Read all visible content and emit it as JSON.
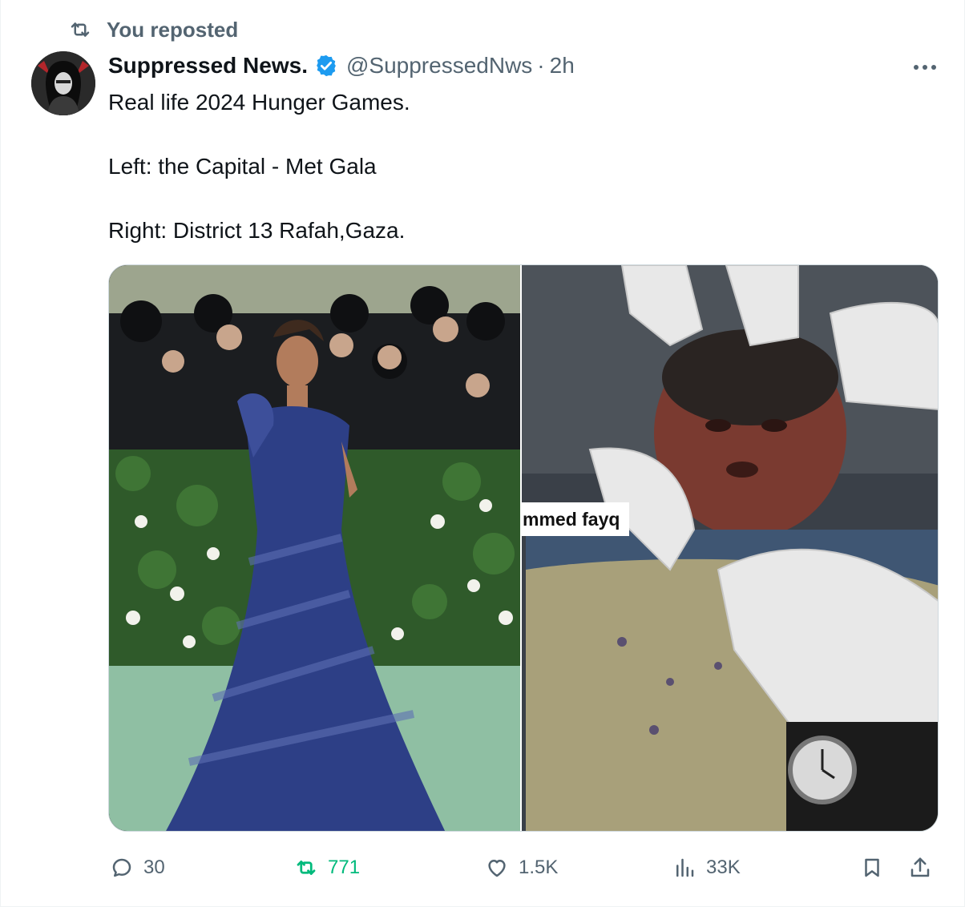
{
  "repost_banner": {
    "label": "You reposted",
    "icon": "repost-icon"
  },
  "author": {
    "display_name": "Suppressed News.",
    "handle": "@SuppressedNws",
    "separator": "·",
    "time": "2h",
    "verified": true
  },
  "tweet": {
    "lines": [
      "Real life 2024 Hunger Games.",
      "Left: the Capital - Met Gala",
      "Right: District 13 Rafah,Gaza."
    ],
    "media": {
      "overlay_caption": "mmed fayq"
    }
  },
  "actions": {
    "reply_count": "30",
    "repost_count": "771",
    "like_count": "1.5K",
    "views_count": "33K"
  },
  "colors": {
    "accent_blue": "#1d9bf0",
    "repost_green": "#00ba7c",
    "secondary_text": "#536471",
    "primary_text": "#0f1419"
  }
}
